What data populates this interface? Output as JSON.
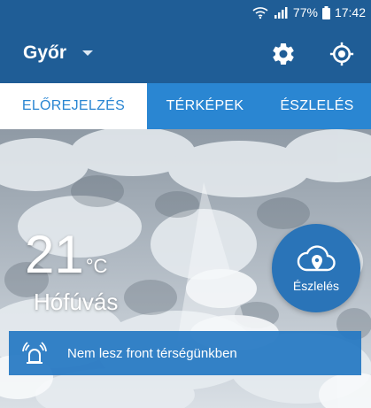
{
  "status_bar": {
    "battery": "77%",
    "time": "17:42"
  },
  "app_bar": {
    "city": "Győr"
  },
  "tabs": [
    {
      "label": "ELŐREJELZÉS",
      "active": true
    },
    {
      "label": "TÉRKÉPEK",
      "active": false
    },
    {
      "label": "ÉSZLELÉS",
      "active": false
    }
  ],
  "weather": {
    "temperature": "21",
    "unit": "°C",
    "condition": "Hófúvás"
  },
  "observe_button": {
    "label": "Észlelés"
  },
  "alert": {
    "text": "Nem lesz front térségünkben"
  },
  "colors": {
    "primary_dark": "#1f5d96",
    "primary": "#2a86d2",
    "alert": "#2678c3"
  }
}
